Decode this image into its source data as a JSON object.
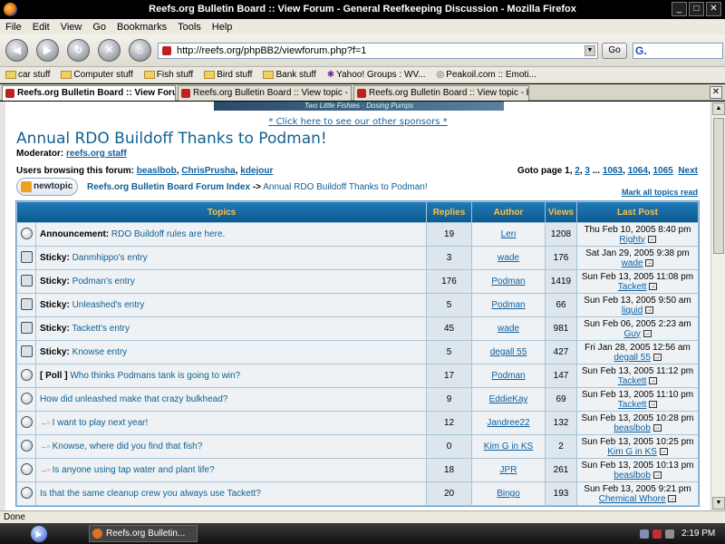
{
  "window": {
    "title": "Reefs.org Bulletin Board :: View Forum - General Reefkeeping Discussion - Mozilla Firefox"
  },
  "menu": [
    "File",
    "Edit",
    "View",
    "Go",
    "Bookmarks",
    "Tools",
    "Help"
  ],
  "nav": {
    "url": "http://reefs.org/phpBB2/viewforum.php?f=1",
    "go_label": "Go",
    "search_glyph": "G."
  },
  "bookmarks": [
    "car stuff",
    "Computer stuff",
    "Fish stuff",
    "Bird stuff",
    "Bank stuff",
    "Yahoo! Groups : WV...",
    "Peakoil.com :: Emoti..."
  ],
  "tabs": [
    "Reefs.org Bulletin Board :: View Foru...",
    "Reefs.org Bulletin Board :: View topic - buil...",
    "Reefs.org Bulletin Board :: View topic - buil..."
  ],
  "page": {
    "banner_text": "Two Little Fishies · Dosing Pumps",
    "sponsor_link": "* Click here to see our other sponsors *",
    "forum_title": "Annual RDO Buildoff Thanks to Podman!",
    "moderator_label": "Moderator:",
    "moderator_name": "reefs.org staff",
    "browsing_label": "Users browsing this forum:",
    "browsing_users": [
      "beaslbob",
      "ChrisPrusha",
      "kdejour"
    ],
    "goto_label": "Goto page",
    "goto_current": "1",
    "goto_pages": [
      "2",
      "3",
      "1063",
      "1064",
      "1065"
    ],
    "goto_next": "Next",
    "newtopic_label": "newtopic",
    "crumb_index": "Reefs.org Bulletin Board Forum Index",
    "crumb_arrow": "->",
    "crumb_current": "Annual RDO Buildoff Thanks to Podman!",
    "mark_read": "Mark all topics read"
  },
  "table": {
    "headers": {
      "topics": "Topics",
      "replies": "Replies",
      "author": "Author",
      "views": "Views",
      "last_post": "Last Post"
    },
    "rows": [
      {
        "icon": "announcement",
        "prefix": "Announcement:",
        "title": "RDO Buildoff rules are here.",
        "replies": "19",
        "author": "Len",
        "views": "1208",
        "last_date": "Thu Feb 10, 2005 8:40 pm",
        "last_user": "Righty"
      },
      {
        "icon": "sticky",
        "prefix": "Sticky:",
        "title": "Danmhippo's entry",
        "replies": "3",
        "author": "wade",
        "views": "176",
        "last_date": "Sat Jan 29, 2005 9:38 pm",
        "last_user": "wade"
      },
      {
        "icon": "sticky",
        "prefix": "Sticky:",
        "title": "Podman's entry",
        "replies": "176",
        "author": "Podman",
        "views": "1419",
        "last_date": "Sun Feb 13, 2005 11:08 pm",
        "last_user": "Tackett"
      },
      {
        "icon": "sticky",
        "prefix": "Sticky:",
        "title": "Unleashed's entry",
        "replies": "5",
        "author": "Podman",
        "views": "66",
        "last_date": "Sun Feb 13, 2005 9:50 am",
        "last_user": "liquid"
      },
      {
        "icon": "sticky",
        "prefix": "Sticky:",
        "title": "Tackett's entry",
        "replies": "45",
        "author": "wade",
        "views": "981",
        "last_date": "Sun Feb 06, 2005 2:23 am",
        "last_user": "Guy"
      },
      {
        "icon": "sticky",
        "prefix": "Sticky:",
        "title": "Knowse entry",
        "replies": "5",
        "author": "degall 55",
        "views": "427",
        "last_date": "Fri Jan 28, 2005 12:56 am",
        "last_user": "degall 55"
      },
      {
        "icon": "topic",
        "prefix": "[ Poll ]",
        "title": "Who thinks Podmans tank is going to win?",
        "replies": "17",
        "author": "Podman",
        "views": "147",
        "last_date": "Sun Feb 13, 2005 11:12 pm",
        "last_user": "Tackett"
      },
      {
        "icon": "topic",
        "prefix": "",
        "title": "How did unleashed make that crazy bulkhead?",
        "replies": "9",
        "author": "EddieKay",
        "views": "69",
        "last_date": "Sun Feb 13, 2005 11:10 pm",
        "last_user": "Tackett"
      },
      {
        "icon": "topic",
        "prefix": "",
        "title": "I want to play next year!",
        "replies": "12",
        "author": "Jandree22",
        "views": "132",
        "last_date": "Sun Feb 13, 2005 10:28 pm",
        "last_user": "beaslbob",
        "flag": "→▫"
      },
      {
        "icon": "topic",
        "prefix": "",
        "title": "Knowse, where did you find that fish?",
        "replies": "0",
        "author": "Kim G in KS",
        "views": "2",
        "last_date": "Sun Feb 13, 2005 10:25 pm",
        "last_user": "Kim G in KS",
        "flag": "→▫"
      },
      {
        "icon": "topic",
        "prefix": "",
        "title": "Is anyone using tap water and plant life?",
        "replies": "18",
        "author": "JPR",
        "views": "261",
        "last_date": "Sun Feb 13, 2005 10:13 pm",
        "last_user": "beaslbob",
        "flag": "→▫"
      },
      {
        "icon": "topic",
        "prefix": "",
        "title": "Is that the same cleanup crew you always use Tackett?",
        "replies": "20",
        "author": "Bingo",
        "views": "193",
        "last_date": "Sun Feb 13, 2005 9:21 pm",
        "last_user": "Chemical Whore"
      }
    ]
  },
  "status": {
    "text": "Done"
  },
  "taskbar": {
    "task_label": "Reefs.org Bulletin...",
    "clock": "2:19 PM"
  }
}
